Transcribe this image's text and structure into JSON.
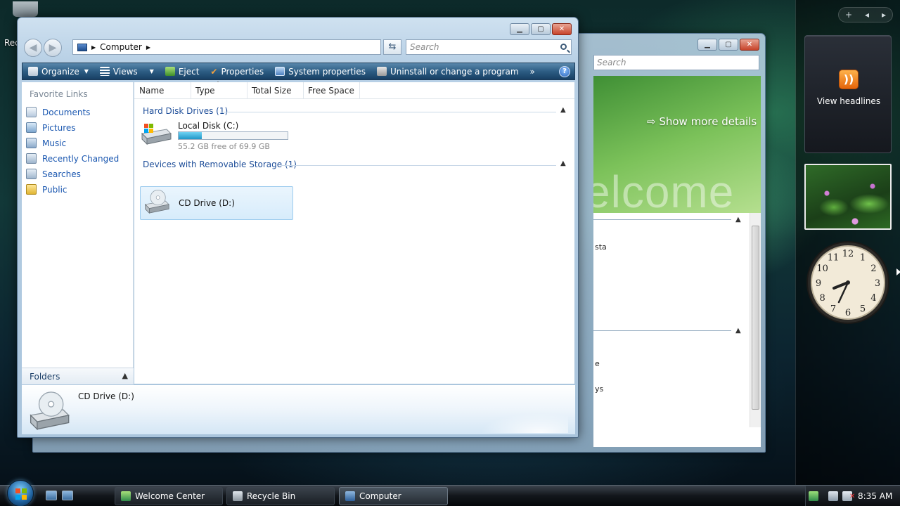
{
  "desktop": {
    "recycle_label_fragment": "Rec"
  },
  "sidebar": {
    "controls": {
      "add": "+",
      "prev": "◂",
      "next": "▸"
    },
    "feed_gadget": {
      "label": "View headlines"
    },
    "clock_gadget": {
      "numbers": [
        "12",
        "1",
        "2",
        "3",
        "4",
        "5",
        "6",
        "7",
        "8",
        "9",
        "10",
        "11"
      ]
    }
  },
  "back_window": {
    "search_placeholder": "Search",
    "banner_link": "Show more details",
    "banner_text": "elcome",
    "fragments": [
      "sta",
      "e",
      "ys"
    ]
  },
  "window": {
    "address": {
      "location": "Computer"
    },
    "search_placeholder": "Search",
    "toolbar": {
      "organize": "Organize",
      "views": "Views",
      "eject": "Eject",
      "properties": "Properties",
      "system_properties": "System properties",
      "uninstall": "Uninstall or change a program",
      "more": "»",
      "help": "?"
    },
    "nav": {
      "favorite_links_title": "Favorite Links",
      "links": [
        "Documents",
        "Pictures",
        "Music",
        "Recently Changed",
        "Searches",
        "Public"
      ],
      "folders_label": "Folders"
    },
    "columns": [
      "Name",
      "Type",
      "Total Size",
      "Free Space"
    ],
    "groups": {
      "hard_disk": "Hard Disk Drives (1)",
      "removable": "Devices with Removable Storage (1)"
    },
    "drives": {
      "c": {
        "name": "Local Disk (C:)",
        "free_text": "55.2 GB free of 69.9 GB",
        "used_fraction": 0.21
      },
      "d": {
        "name": "CD Drive (D:)"
      }
    },
    "details": {
      "name": "CD Drive (D:)"
    }
  },
  "taskbar": {
    "buttons": [
      "Welcome Center",
      "Recycle Bin",
      "Computer"
    ],
    "clock": "8:35 AM"
  },
  "colors": {
    "link": "#1a57b0",
    "toolbar": "#2d5d84",
    "progress": "#1f96c8",
    "group_heading": "#1e4e99"
  }
}
